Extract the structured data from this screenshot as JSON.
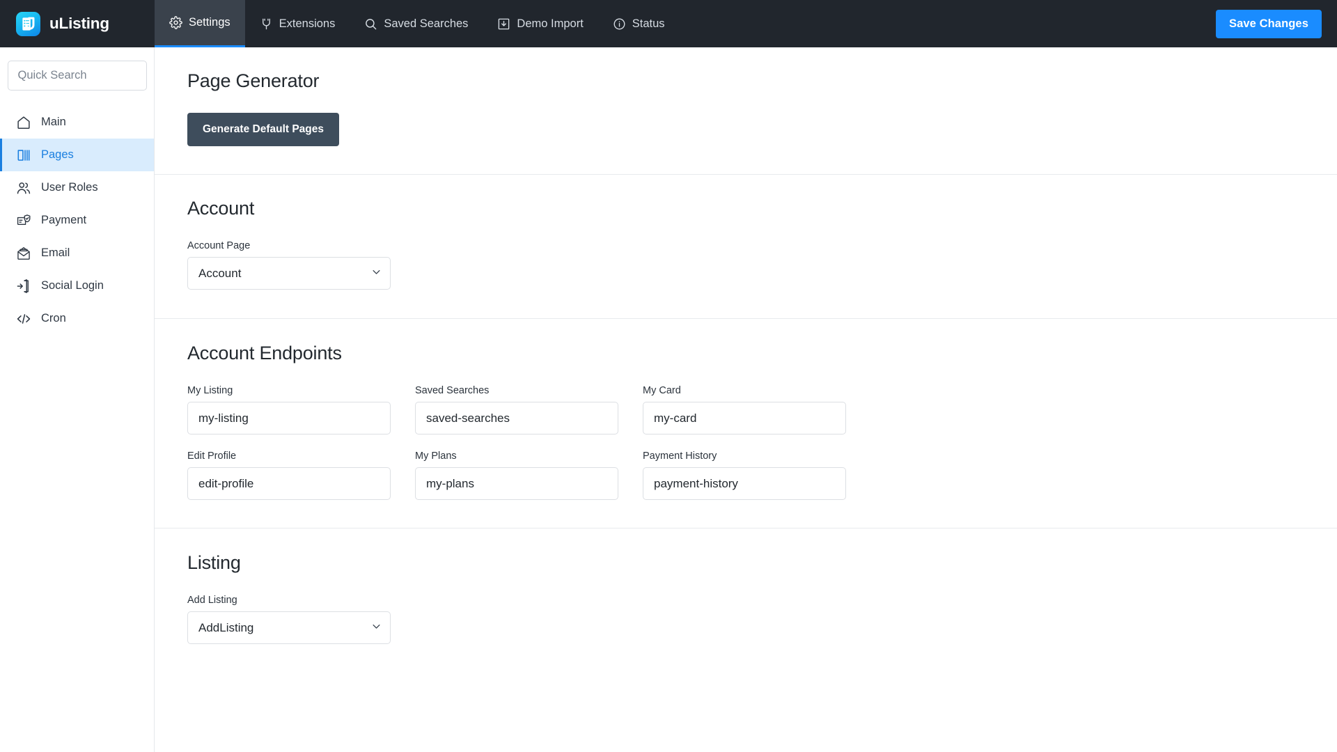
{
  "header": {
    "brand_name": "uListing",
    "brand_logo_icon": "ulisting-logo-icon",
    "nav": [
      {
        "label": "Settings",
        "icon": "gear-icon",
        "active": true
      },
      {
        "label": "Extensions",
        "icon": "plug-icon",
        "active": false
      },
      {
        "label": "Saved Searches",
        "icon": "search-icon",
        "active": false
      },
      {
        "label": "Demo Import",
        "icon": "download-box-icon",
        "active": false
      },
      {
        "label": "Status",
        "icon": "info-circle-icon",
        "active": false
      }
    ],
    "save_button": "Save Changes",
    "accent_color": "#1a8cff",
    "bar_color": "#21262d"
  },
  "sidebar": {
    "search_placeholder": "Quick Search",
    "search_value": "",
    "items": [
      {
        "label": "Main",
        "icon": "home-icon",
        "active": false
      },
      {
        "label": "Pages",
        "icon": "pages-icon",
        "active": true
      },
      {
        "label": "User Roles",
        "icon": "users-icon",
        "active": false
      },
      {
        "label": "Payment",
        "icon": "payment-card-shield-icon",
        "active": false
      },
      {
        "label": "Email",
        "icon": "envelope-icon",
        "active": false
      },
      {
        "label": "Social Login",
        "icon": "login-arrow-icon",
        "active": false
      },
      {
        "label": "Cron",
        "icon": "code-brackets-icon",
        "active": false
      }
    ],
    "active_color": "#1a7fe0",
    "active_bg": "#d9ecfd"
  },
  "main": {
    "page_generator": {
      "title": "Page Generator",
      "button_label": "Generate Default Pages",
      "button_color": "#3e4d5c"
    },
    "account": {
      "title": "Account",
      "field_label": "Account Page",
      "field_value": "Account",
      "options": [
        "Account"
      ]
    },
    "account_endpoints": {
      "title": "Account Endpoints",
      "fields": [
        {
          "label": "My Listing",
          "value": "my-listing"
        },
        {
          "label": "Saved Searches",
          "value": "saved-searches"
        },
        {
          "label": "My Card",
          "value": "my-card"
        },
        {
          "label": "Edit Profile",
          "value": "edit-profile"
        },
        {
          "label": "My Plans",
          "value": "my-plans"
        },
        {
          "label": "Payment History",
          "value": "payment-history"
        }
      ]
    },
    "listing": {
      "title": "Listing",
      "field_label": "Add Listing",
      "field_value": "AddListing",
      "options": [
        "AddListing"
      ]
    }
  }
}
